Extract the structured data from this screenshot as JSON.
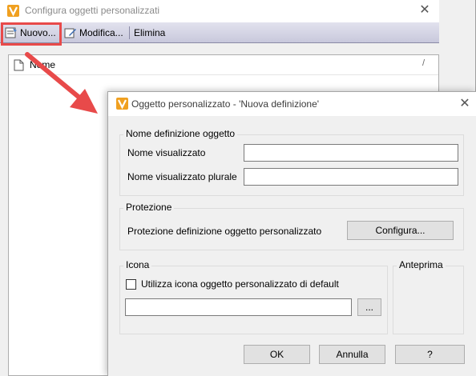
{
  "colors": {
    "highlight": "#e84a4a",
    "arrow": "#e84a4a",
    "app_icon": "#f0a020",
    "menubar": "#d4d4e4"
  },
  "back_window": {
    "title": "Configura oggetti personalizzati",
    "close_glyph": "✕",
    "menu": {
      "new_label": "Nuovo...",
      "edit_label": "Modifica...",
      "delete_label": "Elimina"
    },
    "list": {
      "column_name": "Nome",
      "sort_glyph": "/"
    }
  },
  "dialog": {
    "title": "Oggetto personalizzato - 'Nuova definizione'",
    "close_glyph": "✕",
    "name_group": {
      "label": "Nome definizione oggetto",
      "display_name_label": "Nome visualizzato",
      "display_name_value": "",
      "plural_label": "Nome visualizzato plurale",
      "plural_value": ""
    },
    "protection_group": {
      "label": "Protezione",
      "text": "Protezione definizione oggetto personalizzato",
      "configure_button": "Configura..."
    },
    "icon_group": {
      "label": "Icona",
      "checkbox_label": "Utilizza icona oggetto personalizzato di default",
      "checkbox_checked": false,
      "path_value": "",
      "browse_button": "..."
    },
    "preview_group": {
      "label": "Anteprima"
    },
    "buttons": {
      "ok": "OK",
      "cancel": "Annulla",
      "help": "?"
    }
  }
}
